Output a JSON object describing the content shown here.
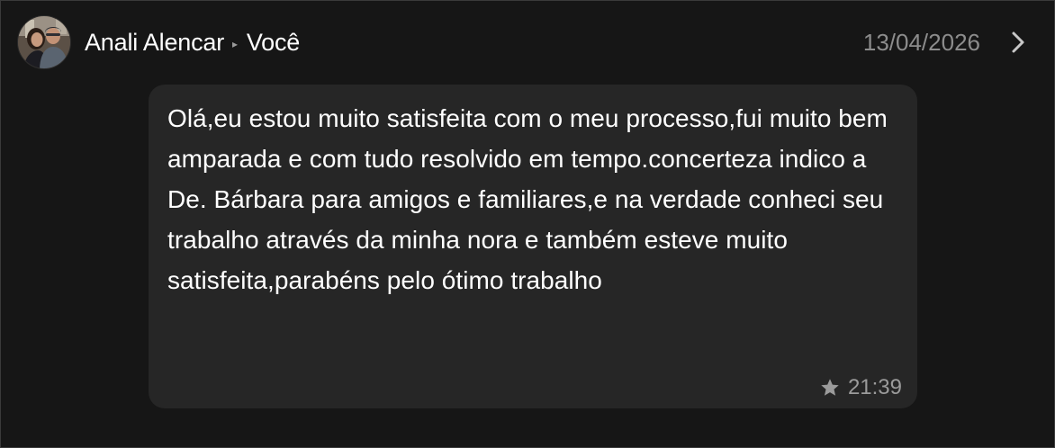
{
  "header": {
    "sender": "Anali Alencar",
    "arrow": "▸",
    "recipient": "Você",
    "date": "13/04/2026"
  },
  "icons": {
    "avatar": "avatar-photo",
    "next": "chevron-right-icon",
    "star": "star-icon"
  },
  "message": {
    "text": "Olá,eu estou muito satisfeita com o meu processo,fui muito bem amparada e com tudo resolvido em tempo.concerteza indico a De. Bárbara para amigos e familiares,e na verdade conheci seu trabalho através da minha nora e também esteve muito satisfeita,parabéns pelo ótimo trabalho",
    "time": "21:39"
  },
  "colors": {
    "background": "#161616",
    "bubble": "#262626",
    "text": "#ffffff",
    "muted": "#8c8c8c"
  }
}
